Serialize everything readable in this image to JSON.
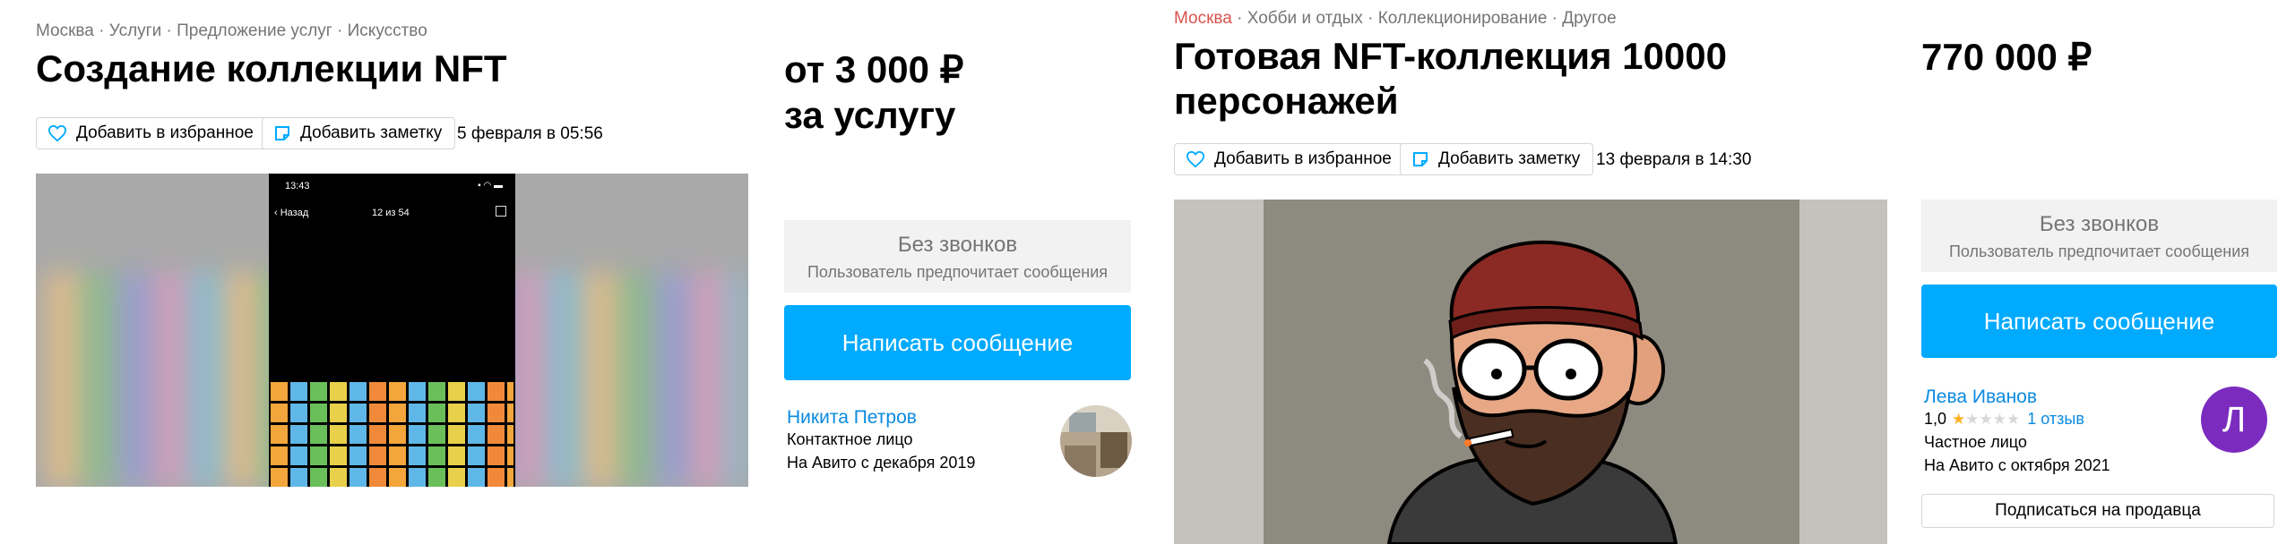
{
  "left": {
    "breadcrumbs": [
      "Москва",
      "Услуги",
      "Предложение услуг",
      "Искусство"
    ],
    "title": "Создание коллекции NFT",
    "price_line1": "от 3 000 ₽",
    "price_line2": "за услугу",
    "favorite_label": "Добавить в избранное",
    "note_label": "Добавить заметку",
    "date": "5 февраля в 05:56",
    "phone": {
      "time": "13:43",
      "back": "Назад",
      "counter": "12 из 54"
    },
    "no_calls_title": "Без звонков",
    "no_calls_subtitle": "Пользователь предпочитает сообщения",
    "message_button": "Написать сообщение",
    "seller_name": "Никита Петров",
    "seller_role": "Контактное лицо",
    "seller_since": "На Авито с декабря 2019"
  },
  "right": {
    "breadcrumbs": [
      "Москва",
      "Хобби и отдых",
      "Коллекционирование",
      "Другое"
    ],
    "title_line1": "Готовая NFT-коллекция 10000",
    "title_line2": "персонажей",
    "price": "770 000 ₽",
    "favorite_label": "Добавить в избранное",
    "note_label": "Добавить заметку",
    "date": "13 февраля в 14:30",
    "no_calls_title": "Без звонков",
    "no_calls_subtitle": "Пользователь предпочитает сообщения",
    "message_button": "Написать сообщение",
    "seller_name": "Лева Иванов",
    "rating": "1,0",
    "rating_stars_filled": 1,
    "rating_stars_total": 5,
    "reviews_link": "1 отзыв",
    "seller_role": "Частное лицо",
    "seller_since": "На Авито с октября 2021",
    "avatar_letter": "Л",
    "subscribe_button": "Подписаться на продавца"
  },
  "colors": {
    "accent": "#00aaff",
    "link": "#0a8ae0",
    "avatar": "#7b2cbf",
    "star": "#ffb021"
  }
}
